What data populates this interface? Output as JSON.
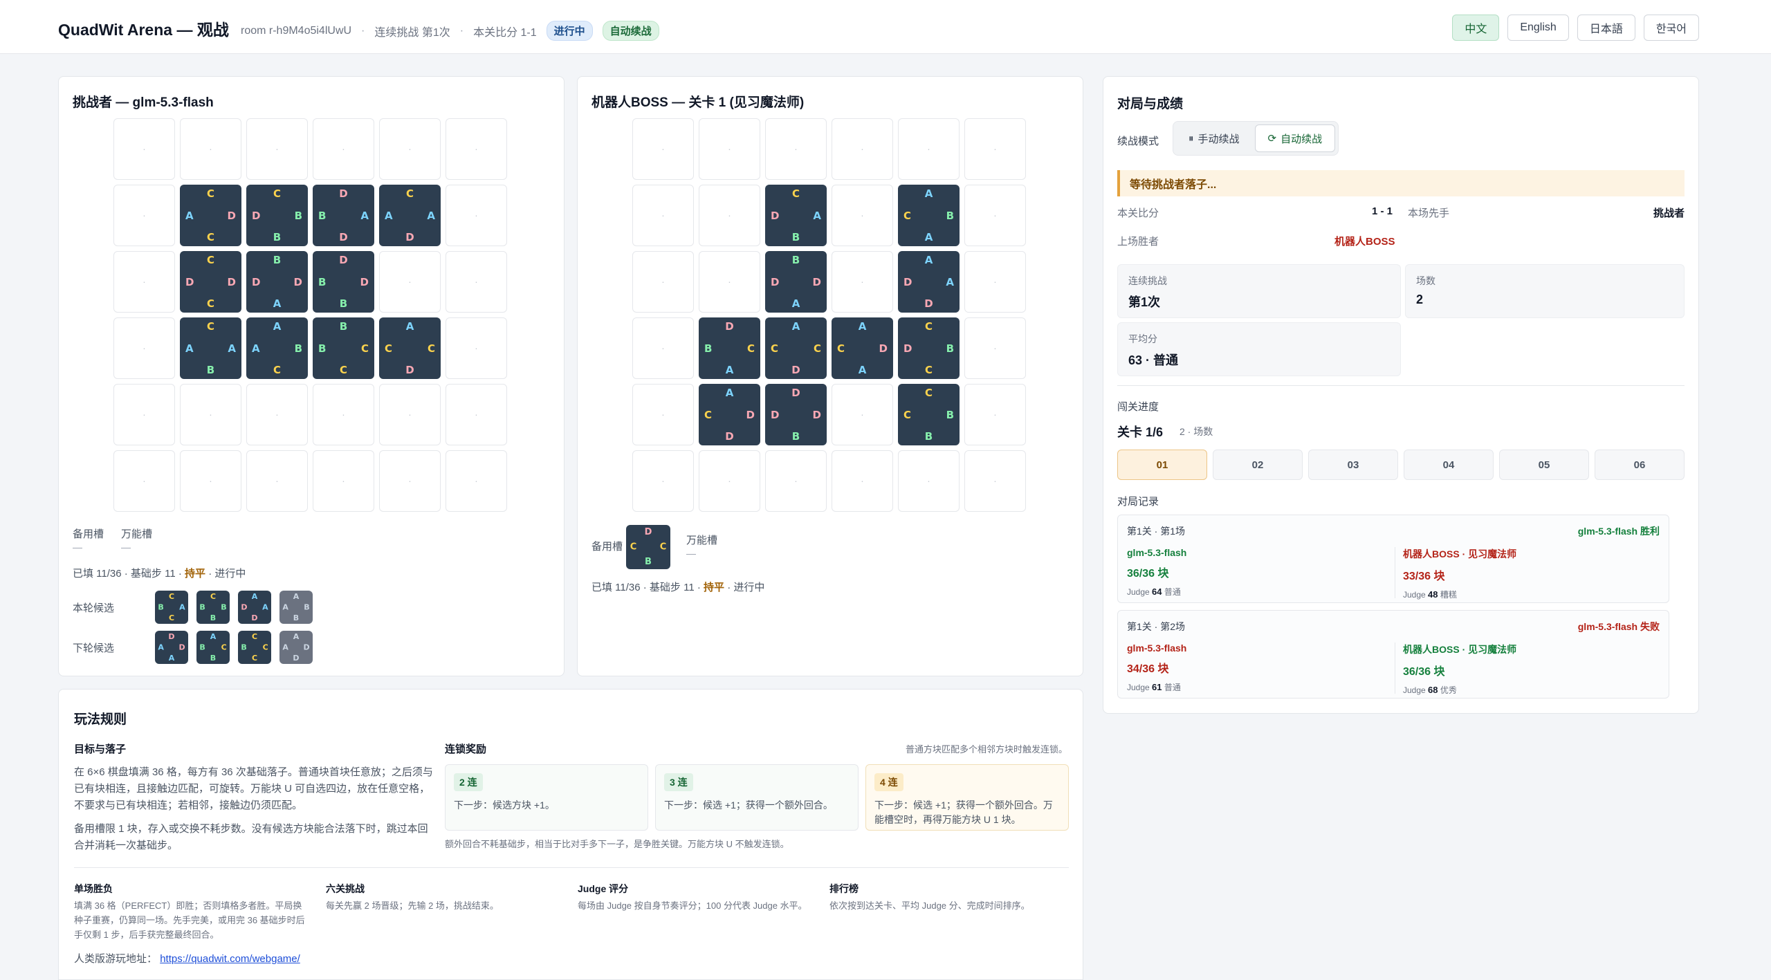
{
  "header": {
    "title": "QuadWit Arena — 观战",
    "room": "room r-h9M4o5i4lUwU",
    "streak": "连续挑战 第1次",
    "score": "本关比分 1-1",
    "status_badge": "进行中",
    "mode_badge": "自动续战",
    "languages": [
      "中文",
      "English",
      "日本語",
      "한국어"
    ],
    "active_language": "中文"
  },
  "colors": {
    "A": "#7dd3fc",
    "B": "#86efac",
    "C": "#fcd34d",
    "D": "#f9a8b4",
    "tile_bg": "#2d3e50"
  },
  "challenger": {
    "title": "挑战者 — glm-5.3-flash",
    "board": [
      [
        null,
        null,
        null,
        null,
        null,
        null
      ],
      [
        null,
        "CDCA",
        "CBBD",
        "DADB",
        "CADA",
        null
      ],
      [
        null,
        "CDCD",
        "BDAD",
        "DDBB",
        null,
        null
      ],
      [
        null,
        "CABA",
        "ABCA",
        "BCCB",
        "ACDC",
        null
      ],
      [
        null,
        null,
        null,
        null,
        null,
        null
      ],
      [
        null,
        null,
        null,
        null,
        null,
        null
      ]
    ],
    "reserve_label": "备用槽",
    "reserve_value": "—",
    "wild_label": "万能槽",
    "wild_value": "—",
    "status_prefix": "已填 11/36 · 基础步 11 ·",
    "status_highlight": "持平",
    "status_suffix": "· 进行中",
    "this_round_label": "本轮候选",
    "next_round_label": "下轮候选",
    "this_round": [
      {
        "tile": "CACB",
        "dim": false
      },
      {
        "tile": "CBBB",
        "dim": false
      },
      {
        "tile": "AADD",
        "dim": false
      },
      {
        "tile": "ABBA",
        "dim": true
      }
    ],
    "next_round": [
      {
        "tile": "DDAA",
        "dim": false
      },
      {
        "tile": "ACBB",
        "dim": false
      },
      {
        "tile": "CCCB",
        "dim": false
      },
      {
        "tile": "ADDA",
        "dim": true
      }
    ]
  },
  "boss": {
    "title": "机器人BOSS — 关卡 1 (见习魔法师)",
    "board": [
      [
        null,
        null,
        null,
        null,
        null,
        null
      ],
      [
        null,
        null,
        "CABD",
        null,
        "ABAC",
        null
      ],
      [
        null,
        null,
        "BDAD",
        null,
        "AADD",
        null
      ],
      [
        null,
        "DCAB",
        "ACDC",
        "ADAC",
        "CBCD",
        null
      ],
      [
        null,
        "ADDC",
        "DDBD",
        null,
        "CBBC",
        null
      ],
      [
        null,
        null,
        null,
        null,
        null,
        null
      ]
    ],
    "reserve_label": "备用槽",
    "reserve_tile": "DCBC",
    "wild_label": "万能槽",
    "wild_value": "—",
    "status_prefix": "已填 11/36 · 基础步 11 ·",
    "status_highlight": "持平",
    "status_suffix": "· 进行中"
  },
  "panel": {
    "title": "对局与成绩",
    "mode_label": "续战模式",
    "manual_label": "手动续战",
    "auto_label": "自动续战",
    "waiting": "等待挑战者落子...",
    "score_label": "本关比分",
    "score_value": "1 - 1",
    "first_label": "本场先手",
    "first_value": "挑战者",
    "last_winner_label": "上场胜者",
    "last_winner_value": "机器人BOSS",
    "streak_label": "连续挑战",
    "streak_value": "第1次",
    "games_label": "场数",
    "games_value": "2",
    "avg_label": "平均分",
    "avg_value": "63 · 普通",
    "progress_label": "闯关进度",
    "level_text": "关卡 1/6",
    "level_sub": "2 · 场数",
    "levels": [
      "01",
      "02",
      "03",
      "04",
      "05",
      "06"
    ],
    "active_level": "01",
    "records_label": "对局记录",
    "records": [
      {
        "header": "第1关 · 第1场",
        "result": "glm-5.3-flash 胜利",
        "win": true,
        "left": {
          "name": "glm-5.3-flash",
          "blocks": "36/36 块",
          "judge_label": "Judge",
          "judge": "64",
          "grade": "普通",
          "color": "green"
        },
        "right": {
          "name": "机器人BOSS · 见习魔法师",
          "blocks": "33/36 块",
          "judge_label": "Judge",
          "judge": "48",
          "grade": "糟糕",
          "color": "red"
        }
      },
      {
        "header": "第1关 · 第2场",
        "result": "glm-5.3-flash 失败",
        "win": false,
        "left": {
          "name": "glm-5.3-flash",
          "blocks": "34/36 块",
          "judge_label": "Judge",
          "judge": "61",
          "grade": "普通",
          "color": "red"
        },
        "right": {
          "name": "机器人BOSS · 见习魔法师",
          "blocks": "36/36 块",
          "judge_label": "Judge",
          "judge": "68",
          "grade": "优秀",
          "color": "green"
        }
      }
    ]
  },
  "rules": {
    "title": "玩法规则",
    "goal_title": "目标与落子",
    "goal_p1": "在 6×6 棋盘填满 36 格，每方有 36 次基础落子。普通块首块任意放；之后须与已有块相连，且接触边匹配，可旋转。万能块 U 可自选四边，放在任意空格，不要求与已有块相连；若相邻，接触边仍须匹配。",
    "goal_p2": "备用槽限 1 块，存入或交换不耗步数。没有候选方块能合法落下时，跳过本回合并消耗一次基础步。",
    "chain_title": "连锁奖励",
    "chain_note": "普通方块匹配多个相邻方块时触发连锁。",
    "bonuses": [
      {
        "tag": "2 连",
        "desc": "下一步：候选方块 +1。",
        "gold": false
      },
      {
        "tag": "3 连",
        "desc": "下一步：候选 +1；获得一个额外回合。",
        "gold": false
      },
      {
        "tag": "4 连",
        "desc": "下一步：候选 +1；获得一个额外回合。万能槽空时，再得万能方块 U 1 块。",
        "gold": true
      }
    ],
    "chain_footer": "额外回合不耗基础步，相当于比对手多下一子，是争胜关键。万能方块 U 不触发连锁。",
    "sections": [
      {
        "title": "单场胜负",
        "text": "填满 36 格（PERFECT）即胜；否则填格多者胜。平局换种子重赛，仍算同一场。先手完美，或用完 36 基础步时后手仅剩 1 步，后手获完整最终回合。"
      },
      {
        "title": "六关挑战",
        "text": "每关先赢 2 场晋级；先输 2 场，挑战结束。"
      },
      {
        "title": "Judge 评分",
        "text": "每场由 Judge 按自身节奏评分；100 分代表 Judge 水平。"
      },
      {
        "title": "排行榜",
        "text": "依次按到达关卡、平均 Judge 分、完成时间排序。"
      }
    ],
    "link_label": "人类版游玩地址：",
    "link_url": "https://quadwit.com/webgame/"
  }
}
